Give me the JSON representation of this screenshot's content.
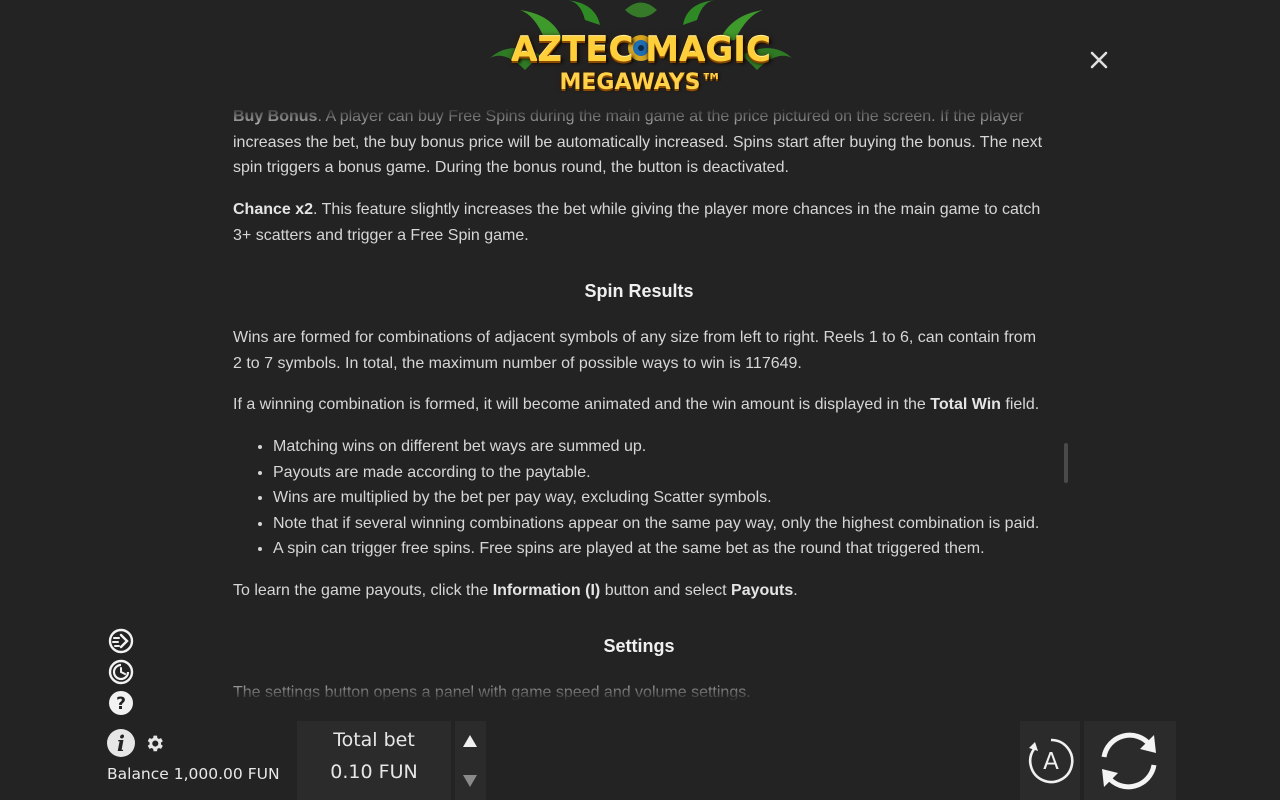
{
  "logo": {
    "line1": "AZTEC MAGIC",
    "line2": "MEGAWAYS™"
  },
  "content": {
    "p1": {
      "bold": "Buy Bonus",
      "text": ". A player can buy Free Spins during the main game at the price pictured on the screen. If the player increases the bet, the buy bonus price will be automatically increased. Spins start after buying the bonus. The next spin triggers a bonus game. During the bonus round, the button is deactivated."
    },
    "p2": {
      "bold": "Chance x2",
      "text": ". This feature slightly increases the bet while giving the player more chances in the main game to catch 3+ scatters and trigger a Free Spin game."
    },
    "spin_results_heading": "Spin Results",
    "p3": "Wins are formed for combinations of adjacent symbols of any size from left to right. Reels 1 to 6, can contain from 2 to 7 symbols. In total, the maximum number of possible ways to win is 117649.",
    "p4": {
      "text_before": "If a winning combination is formed, it will become animated and the win amount is displayed in the ",
      "bold": "Total Win",
      "text_after": " field."
    },
    "bullets": [
      "Matching wins on different bet ways are summed up.",
      "Payouts are made according to the paytable.",
      "Wins are multiplied by the bet per pay way, excluding Scatter symbols.",
      "Note that if several winning combinations appear on the same pay way, only the highest combination is paid.",
      "A spin can trigger free spins. Free spins are played at the same bet as the round that triggered them."
    ],
    "p5": {
      "text_before": "To learn the game payouts, click the ",
      "bold1": "Information (I)",
      "text_mid": " button and select ",
      "bold2": "Payouts",
      "text_after": "."
    },
    "settings_heading": "Settings",
    "p6": "The settings button opens a panel with game speed and volume settings."
  },
  "footer": {
    "balance": "Balance 1,000.00 FUN",
    "total_bet_label": "Total bet",
    "total_bet_value": "0.10 FUN",
    "auto_label": "A"
  },
  "icons": {
    "close": "close-icon",
    "turbo": "turbo-speed-icon",
    "history": "history-icon",
    "help": "help-icon",
    "info": "info-icon",
    "settings": "gear-icon",
    "bet_up": "arrow-up-icon",
    "bet_down": "arrow-down-icon",
    "autoplay": "autoplay-icon",
    "spin": "spin-icon"
  },
  "colors": {
    "background": "#232323",
    "panel": "#2b2b2b",
    "logo_gold": "#ffcf3a"
  }
}
